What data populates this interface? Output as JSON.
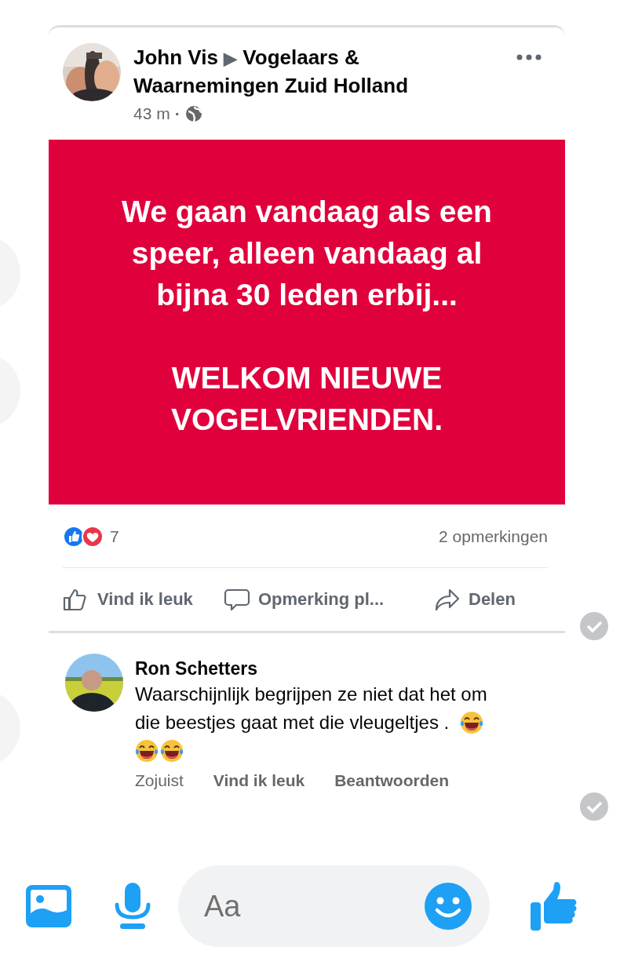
{
  "post": {
    "author": "John Vis",
    "arrow": "▶",
    "group": "Vogelaars & Waarnemingen Zuid Holland",
    "time": "43 m",
    "separator": "·",
    "audience": {
      "kind": "public"
    },
    "banner": {
      "color": "#e0003c",
      "paragraphs": [
        [
          "We gaan vandaag als een",
          "speer, alleen vandaag al",
          "bijna 30 leden erbij..."
        ],
        [
          "WELKOM NIEUWE",
          "VOGELVRIENDEN."
        ]
      ]
    },
    "reactions": {
      "types": [
        {
          "kind": "like"
        },
        {
          "kind": "love"
        }
      ],
      "count": "7"
    },
    "comments_count": "2 opmerkingen",
    "actions": [
      {
        "kind": "like",
        "label": "Vind ik leuk"
      },
      {
        "kind": "comment",
        "label": "Opmerking pl..."
      },
      {
        "kind": "share",
        "label": "Delen"
      }
    ]
  },
  "comment": {
    "author": "Ron Schetters",
    "lines": [
      {
        "text": "Waarschijnlijk begrijpen ze niet dat het om"
      },
      {
        "text": "die beestjes gaat met die vleugeltjes .",
        "emojis": [
          {
            "kind": "tears-of-joy"
          }
        ]
      },
      {
        "emojis": [
          {
            "kind": "tears-of-joy"
          },
          {
            "kind": "tears-of-joy"
          }
        ]
      }
    ],
    "time": "Zojuist",
    "actions": [
      "Vind ik leuk",
      "Beantwoorden"
    ]
  },
  "composer": {
    "placeholder": "Aa"
  }
}
